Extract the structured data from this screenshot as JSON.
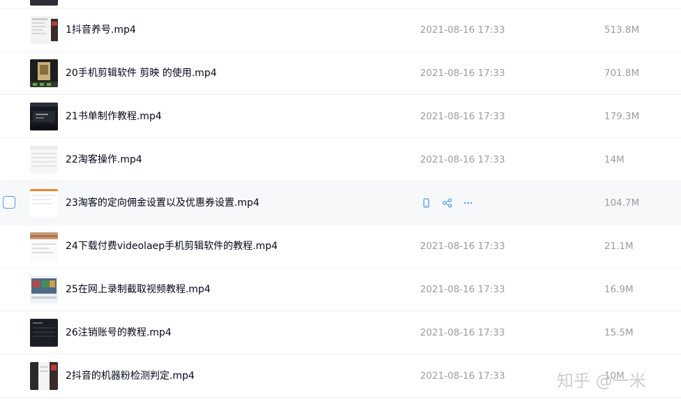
{
  "files": [
    {
      "name": "1抖音养号.mp4",
      "time": "2021-08-16 17:33",
      "size": "513.8M",
      "thumb": "doc-light"
    },
    {
      "name": "20手机剪辑软件 剪映 的使用.mp4",
      "time": "2021-08-16 17:33",
      "size": "701.8M",
      "thumb": "phone-dark"
    },
    {
      "name": "21书单制作教程.mp4",
      "time": "2021-08-16 17:33",
      "size": "179.3M",
      "thumb": "dark-screen"
    },
    {
      "name": "22淘客操作.mp4",
      "time": "2021-08-16 17:33",
      "size": "14M",
      "thumb": "blank-light"
    },
    {
      "name": "23淘客的定向佣金设置以及优惠券设置.mp4",
      "time": "",
      "size": "104.7M",
      "thumb": "orange-bar",
      "hovered": true
    },
    {
      "name": "24下载付费videolaep手机剪辑软件的教程.mp4",
      "time": "2021-08-16 17:33",
      "size": "21.1M",
      "thumb": "web-light"
    },
    {
      "name": "25在网上录制截取视频教程.mp4",
      "time": "2021-08-16 17:33",
      "size": "16.9M",
      "thumb": "video-site"
    },
    {
      "name": "26注销账号的教程.mp4",
      "time": "2021-08-16 17:33",
      "size": "15.5M",
      "thumb": "dark-app"
    },
    {
      "name": "2抖音的机器粉检测判定.mp4",
      "time": "2021-08-16 17:33",
      "size": "10M",
      "thumb": "red-dark"
    }
  ],
  "row_actions": {
    "icons": [
      "phone-icon",
      "share-icon",
      "more-icon"
    ]
  },
  "watermark": "知乎 @一米",
  "colors": {
    "accent": "#4b9bf2",
    "text": "#03081a",
    "muted": "#9a9ca6",
    "hover_bg": "#f7f8fa"
  }
}
